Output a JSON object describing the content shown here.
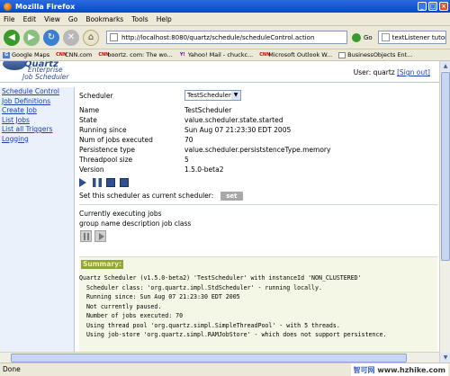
{
  "window": {
    "title": "Mozilla Firefox"
  },
  "menu": [
    "File",
    "Edit",
    "View",
    "Go",
    "Bookmarks",
    "Tools",
    "Help"
  ],
  "nav": {
    "url": "http://localhost:8080/quartz/schedule/scheduleControl.action",
    "go_label": "Go",
    "search_text": "textListener tutorial"
  },
  "bookmarks": [
    {
      "icon": "google-icon",
      "label": "Google Maps"
    },
    {
      "icon": "cnn-icon",
      "label": "CNN.com"
    },
    {
      "icon": "cnn-icon",
      "label": "boortz. com: The wo..."
    },
    {
      "icon": "yahoo-icon",
      "label": "Yahoo! Mail - chuckc..."
    },
    {
      "icon": "cnn-icon",
      "label": "Microsoft Outlook W..."
    },
    {
      "icon": "page-icon",
      "label": "BusinessObjects Ent..."
    }
  ],
  "app": {
    "logo_line1": "Quartz",
    "logo_line2": "Enterprise",
    "logo_line3": "Job Scheduler",
    "user_label": "User: quartz",
    "sign_out": "[Sign out]"
  },
  "sidebar": [
    "Schedule Control",
    "Job Definitions",
    "Create Job",
    "List Jobs",
    "List all Triggers",
    "Logging"
  ],
  "scheduler": {
    "select_label": "Scheduler",
    "select_value": "TestScheduler",
    "rows": [
      {
        "label": "Name",
        "value": "TestScheduler"
      },
      {
        "label": "State",
        "value": "value.scheduler.state.started"
      },
      {
        "label": "Running since",
        "value": "Sun Aug 07 21:23:30 EDT 2005"
      },
      {
        "label": "Num of jobs executed",
        "value": "70"
      },
      {
        "label": "Persistence type",
        "value": "value.scheduler.persiststenceType.memory"
      },
      {
        "label": "Threadpool size",
        "value": "5"
      },
      {
        "label": "Version",
        "value": "1.5.0-beta2"
      }
    ],
    "set_current_label": "Set this scheduler as current scheduler:",
    "set_button": "set"
  },
  "executing": {
    "title": "Currently executing jobs",
    "columns_header": "group name description job class"
  },
  "summary": {
    "label": "Summary:",
    "lines": [
      "Quartz Scheduler (v1.5.0-beta2) 'TestScheduler' with instanceId 'NON_CLUSTERED'",
      "  Scheduler class: 'org.quartz.impl.StdScheduler' - running locally.",
      "  Running since: Sun Aug 07 21:23:30 EDT 2005",
      "  Not currently paused.",
      "  Number of jobs executed: 70",
      "  Using thread pool 'org.quartz.simpl.SimpleThreadPool' - with 5 threads.",
      "  Using job-store 'org.quartz.simpl.RAMJobStore' - which does not support persistence."
    ]
  },
  "status": {
    "text": "Done"
  },
  "watermark": {
    "part1": "智可网",
    "part2": "www.hzhike.com"
  },
  "colors": {
    "link": "#1a3fb8",
    "sidebar_bg": "#eaf1fb",
    "summary_label_bg": "#8fa43a"
  }
}
